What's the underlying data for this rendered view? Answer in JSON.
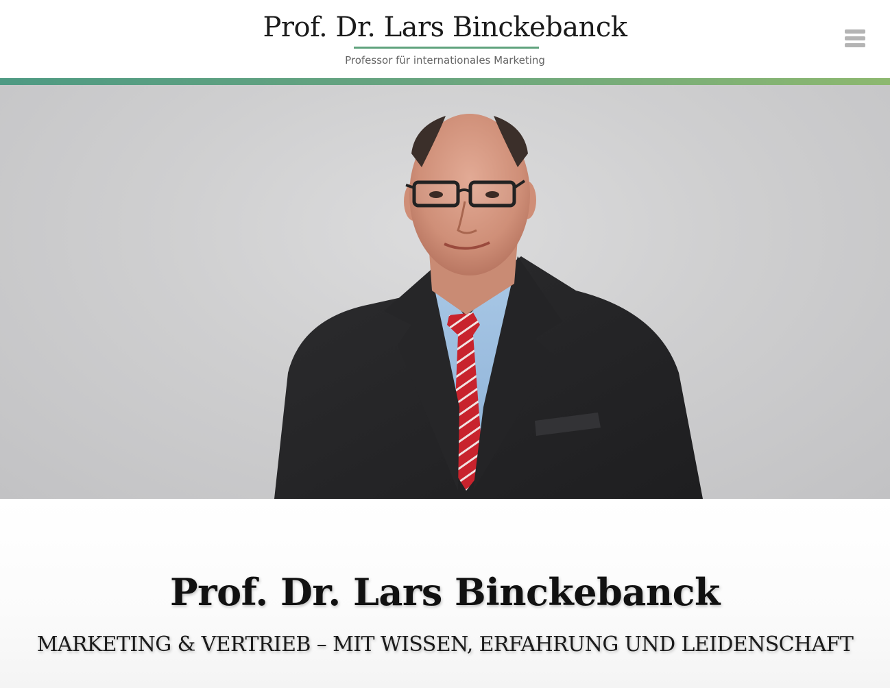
{
  "header": {
    "logo_title": "Prof. Dr. Lars Binckebanck",
    "logo_subtitle": "Professor für internationales Marketing",
    "menu_icon": "hamburger-menu-icon",
    "accent_rule_color": "#5fa27d",
    "accent_bar_colors": [
      "#4e9a83",
      "#8db86f"
    ]
  },
  "hero": {
    "image": "portrait-photo"
  },
  "intro": {
    "title": "Prof. Dr. Lars Binckebanck",
    "tagline": "MARKETING & VERTRIEB – MIT WISSEN, ERFAHRUNG UND LEIDENSCHAFT"
  }
}
